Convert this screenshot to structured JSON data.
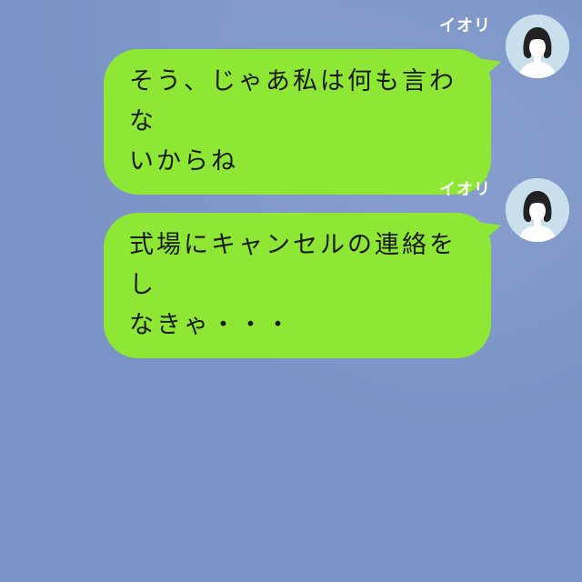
{
  "messages": [
    {
      "sender": "イオリ",
      "line1": "そう、じゃあ私は何も言わな",
      "line2": "いからね"
    },
    {
      "sender": "イオリ",
      "line1": "式場にキャンセルの連絡をし",
      "line2": "なきゃ・・・"
    }
  ],
  "colors": {
    "background": "#7b93c6",
    "bubble": "#8ee635",
    "avatar_bg": "#c9dfec"
  },
  "icons": {
    "avatar": "woman-avatar-icon"
  }
}
